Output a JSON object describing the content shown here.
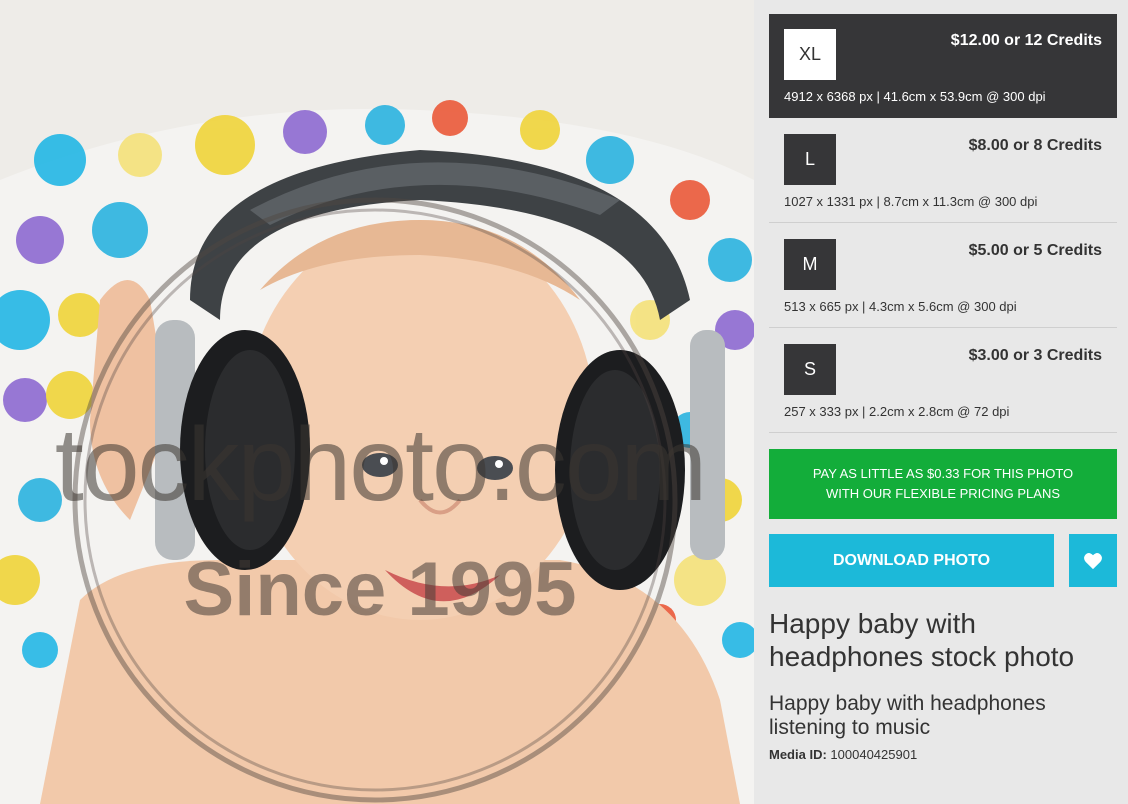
{
  "photo": {
    "alt": "Happy baby with headphones",
    "watermark_main": "tockphoto.com",
    "watermark_sub": "Since 1995"
  },
  "sizes": [
    {
      "code": "XL",
      "price": "$12.00 or 12 Credits",
      "dims": "4912 x 6368 px | 41.6cm x 53.9cm @ 300 dpi",
      "selected": true
    },
    {
      "code": "L",
      "price": "$8.00 or 8 Credits",
      "dims": "1027 x 1331 px | 8.7cm x 11.3cm @ 300 dpi"
    },
    {
      "code": "M",
      "price": "$5.00 or 5 Credits",
      "dims": "513 x 665 px | 4.3cm x 5.6cm @ 300 dpi"
    },
    {
      "code": "S",
      "price": "$3.00 or 3 Credits",
      "dims": "257 x 333 px | 2.2cm x 2.8cm @ 72 dpi"
    }
  ],
  "promo": {
    "line1": "PAY AS LITTLE AS $0.33 FOR THIS PHOTO",
    "line2": "WITH OUR FLEXIBLE PRICING PLANS"
  },
  "actions": {
    "download_label": "DOWNLOAD PHOTO",
    "favorite_icon": "heart-icon"
  },
  "details": {
    "title": "Happy baby with headphones stock photo",
    "subtitle": "Happy baby with headphones listening to music",
    "media_id_label": "Media ID:",
    "media_id": "100040425901"
  },
  "colors": {
    "dark": "#363638",
    "green": "#13ad3a",
    "cyan": "#1cb9d9"
  }
}
